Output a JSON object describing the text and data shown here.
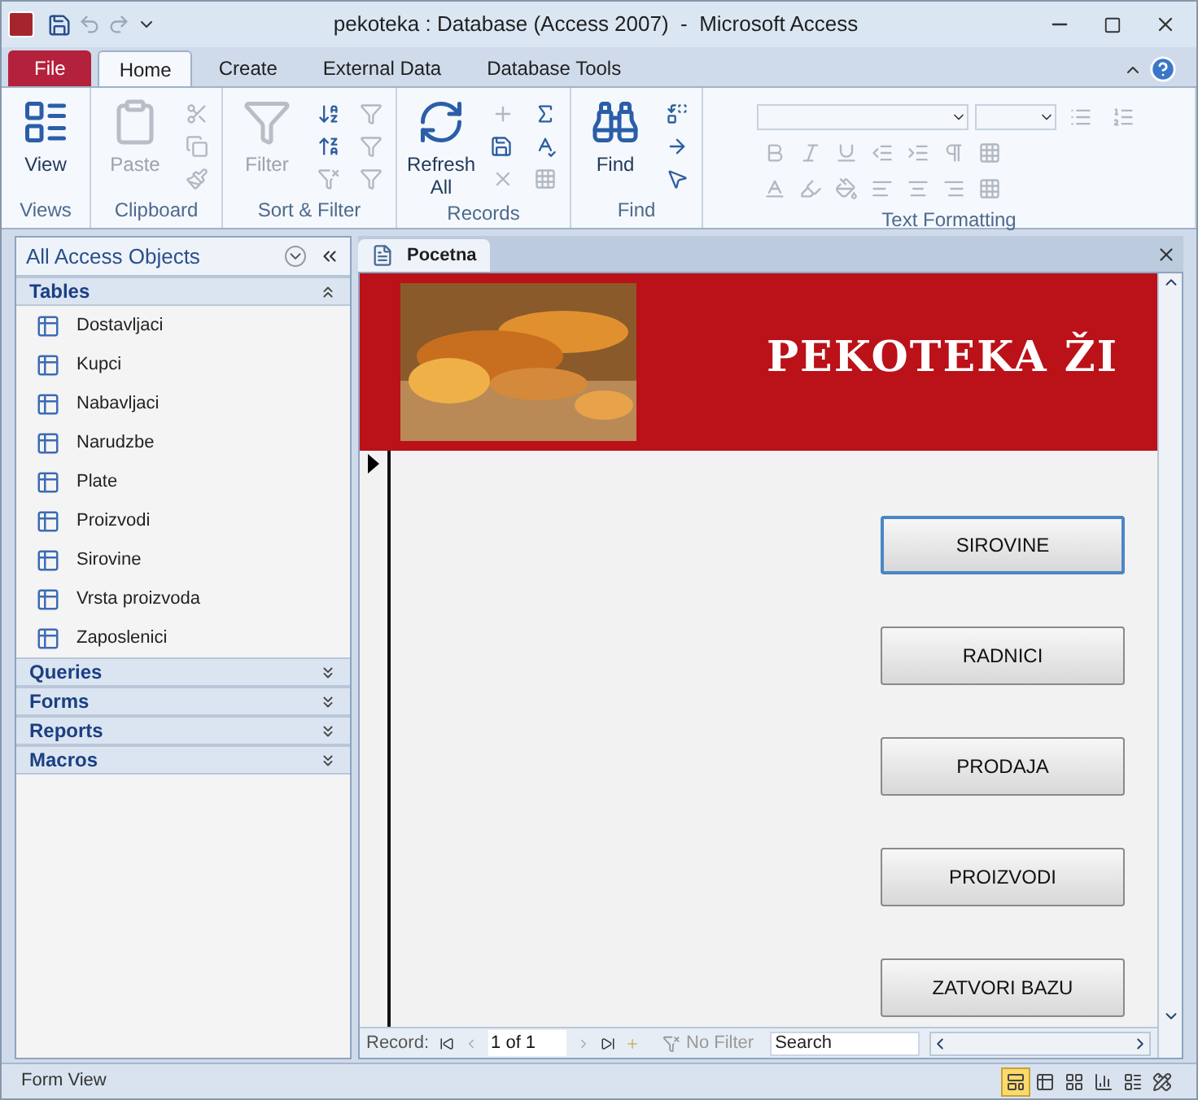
{
  "window": {
    "title": "pekoteka : Database (Access 2007)  -  Microsoft Access"
  },
  "ribbon_tabs": [
    {
      "label": "File",
      "kind": "file"
    },
    {
      "label": "Home",
      "kind": "tab",
      "selected": true
    },
    {
      "label": "Create",
      "kind": "tab",
      "selected": false
    },
    {
      "label": "External Data",
      "kind": "tab",
      "selected": false
    },
    {
      "label": "Database Tools",
      "kind": "tab",
      "selected": false
    }
  ],
  "ribbon_groups": [
    {
      "label": "Views",
      "kind": "views",
      "button": {
        "label": "View",
        "disabled": false
      }
    },
    {
      "label": "Clipboard",
      "kind": "clipboard",
      "button": {
        "label": "Paste",
        "disabled": true
      }
    },
    {
      "label": "Sort & Filter",
      "kind": "sort",
      "button": {
        "label": "Filter",
        "disabled": true
      }
    },
    {
      "label": "Records",
      "kind": "records",
      "button": {
        "label": "Refresh All",
        "disabled": false
      }
    },
    {
      "label": "Find",
      "kind": "find",
      "button": {
        "label": "Find",
        "disabled": false
      }
    },
    {
      "label": "Text Formatting",
      "kind": "text"
    }
  ],
  "navigation": {
    "title": "All Access Objects",
    "groups": [
      {
        "label": "Tables",
        "expanded": true,
        "items": [
          "Dostavljaci",
          "Kupci",
          "Nabavljaci",
          "Narudzbe",
          "Plate",
          "Proizvodi",
          "Sirovine",
          "Vrsta proizvoda",
          "Zaposlenici"
        ]
      },
      {
        "label": "Queries",
        "expanded": false
      },
      {
        "label": "Forms",
        "expanded": false
      },
      {
        "label": "Reports",
        "expanded": false
      },
      {
        "label": "Macros",
        "expanded": false
      }
    ]
  },
  "document_tab": {
    "label": "Pocetna"
  },
  "form": {
    "heading": "PEKOTEKA ŽI",
    "buttons": [
      {
        "label": "SIROVINE",
        "focused": true
      },
      {
        "label": "RADNICI",
        "focused": false
      },
      {
        "label": "PRODAJA",
        "focused": false
      },
      {
        "label": "PROIZVODI",
        "focused": false
      },
      {
        "label": "ZATVORI BAZU",
        "focused": false
      }
    ]
  },
  "record_nav": {
    "label": "Record:",
    "position": "1 of 1",
    "filter": "No Filter",
    "search_placeholder": "Search"
  },
  "status_bar": {
    "text": "Form View",
    "views": [
      {
        "selected": true
      },
      {
        "selected": false
      },
      {
        "selected": false
      },
      {
        "selected": false
      },
      {
        "selected": false
      },
      {
        "selected": false
      }
    ]
  }
}
